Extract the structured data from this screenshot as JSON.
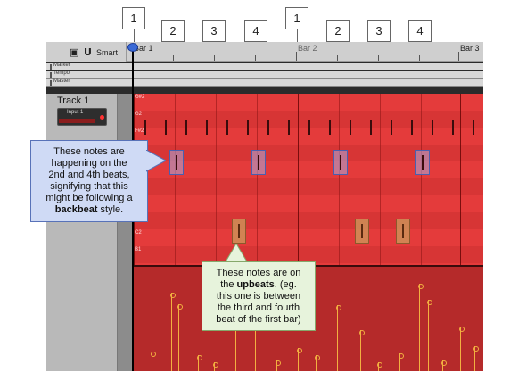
{
  "ruler": {
    "bar1": "Bar 1",
    "bar2": "Bar 2",
    "bar3": "Bar 3",
    "smart_label": "Smart"
  },
  "beat_labels": [
    "1",
    "2",
    "3",
    "4",
    "1",
    "2",
    "3",
    "4"
  ],
  "global_tracks": [
    "Marker",
    "Tempo",
    "Master"
  ],
  "track": {
    "name": "Track 1",
    "input_label": "Input 1"
  },
  "piano_roll": {
    "note_labels": [
      "G#2",
      "G2",
      "F#2",
      "",
      "",
      "",
      "",
      "C2",
      "B1"
    ]
  },
  "callouts": {
    "backbeat": {
      "line1": "These notes are",
      "line2": "happening on the",
      "line3": "2nd and 4th beats,",
      "line4": "signifying that this",
      "line5": "might be following a",
      "bold": "backbeat",
      "tail": " style."
    },
    "upbeats": {
      "line1": "These notes are on",
      "pre": "the ",
      "bold": "upbeats",
      "post": ". (eg.",
      "line3": "this one is between",
      "line4": "the third and fourth",
      "line5": "beat of the first bar)"
    }
  },
  "colors": {
    "roll_bg": "#e43b3b",
    "velocity_bg": "#b52a2a",
    "highlight_blue": "#cfdaf5",
    "highlight_green": "#e7f3dc",
    "velocity_stem": "#f2b040"
  }
}
